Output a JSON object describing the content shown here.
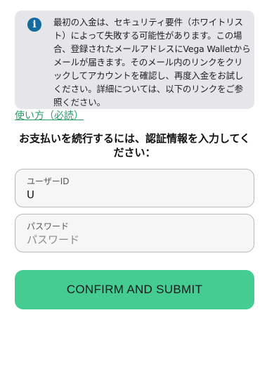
{
  "notice": {
    "icon": "info-icon",
    "icon_glyph": "i",
    "text": "最初の入金は、セキュリティ要件（ホワイトリスト）によって失敗する可能性があります。この場合、登録されたメールアドレスにVega Walletからメールが届きます。そのメール内のリンクをクリックしてアカウントを確認し、再度入金をお試しください。詳細については、以下のリンクをご参照ください。"
  },
  "usage_link": "使い方（必読）",
  "heading": "お支払いを続行するには、認証情報を入力してください：",
  "form": {
    "user_id": {
      "label": "ユーザーID",
      "value": "U",
      "placeholder": "ユーザーID"
    },
    "password": {
      "label": "パスワード",
      "value": "",
      "placeholder": "パスワード"
    },
    "submit_label": "CONFIRM AND SUBMIT"
  },
  "colors": {
    "accent": "#44cc92",
    "link": "#2a9a68",
    "info_icon": "#146b9e",
    "notice_bg": "#e6e6ea"
  }
}
